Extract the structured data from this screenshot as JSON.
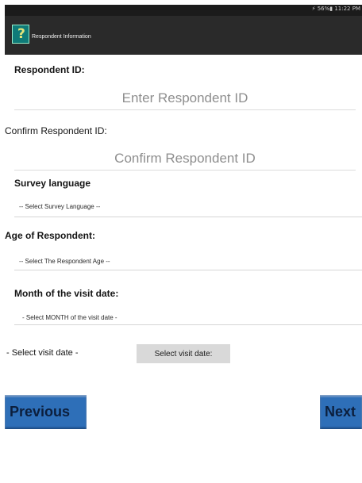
{
  "status_bar": {
    "text": "⚡ 56%▮ 11:22 PM"
  },
  "app_bar": {
    "title": "Respondent Information"
  },
  "form": {
    "respondent_id_label": "Respondent ID:",
    "respondent_id_placeholder": "Enter Respondent ID",
    "confirm_label": "Confirm Respondent ID:",
    "confirm_placeholder": "Confirm Respondent ID",
    "language_label": "Survey language",
    "language_select": "-- Select Survey Language --",
    "age_label": "Age of Respondent:",
    "age_select": "-- Select The Respondent Age --",
    "month_label": "Month of the visit date:",
    "month_select": "- Select MONTH of the visit date -",
    "visit_date_label": "- Select visit date -",
    "visit_date_button": "Select visit date:"
  },
  "nav": {
    "previous": "Previous",
    "next": "Next"
  }
}
